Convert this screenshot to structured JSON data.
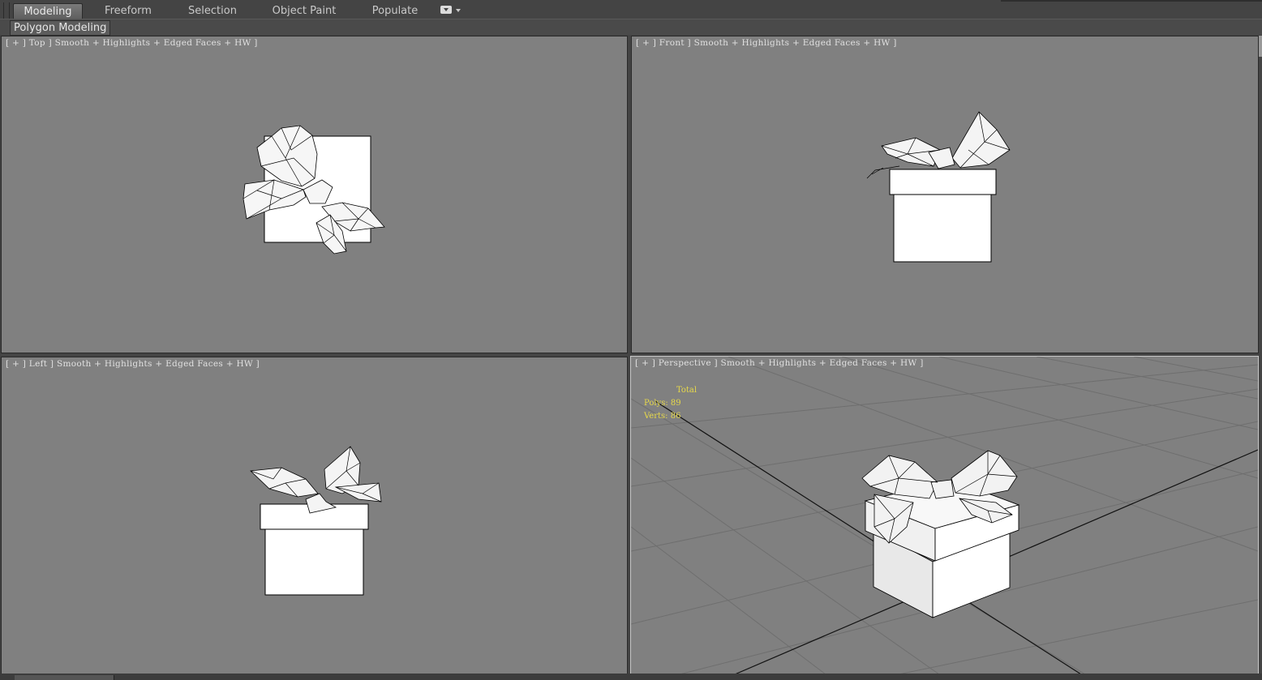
{
  "ribbon": {
    "tabs": [
      {
        "label": "Modeling",
        "active": true
      },
      {
        "label": "Freeform"
      },
      {
        "label": "Selection"
      },
      {
        "label": "Object Paint"
      },
      {
        "label": "Populate"
      }
    ]
  },
  "subribbon": {
    "label": "Polygon Modeling"
  },
  "viewports": {
    "top": {
      "label": "[ + ] Top ] Smooth + Highlights + Edged Faces + HW ]"
    },
    "front": {
      "label": "[ + ] Front ] Smooth + Highlights + Edged Faces + HW ]"
    },
    "left": {
      "label": "[ + ] Left ] Smooth + Highlights + Edged Faces + HW ]"
    },
    "perspective": {
      "label": "[ + ] Perspective ] Smooth + Highlights + Edged Faces + HW ]",
      "stats": {
        "header": "Total",
        "polys": "Polys: 89",
        "verts": "Verts: 86"
      }
    }
  },
  "colors": {
    "viewport_bg": "#808080",
    "ui_bg": "#444444",
    "stats_text": "#e6d84a",
    "active_border": "#c8c8c8"
  },
  "icons": [
    "dropdown-menu-icon"
  ]
}
